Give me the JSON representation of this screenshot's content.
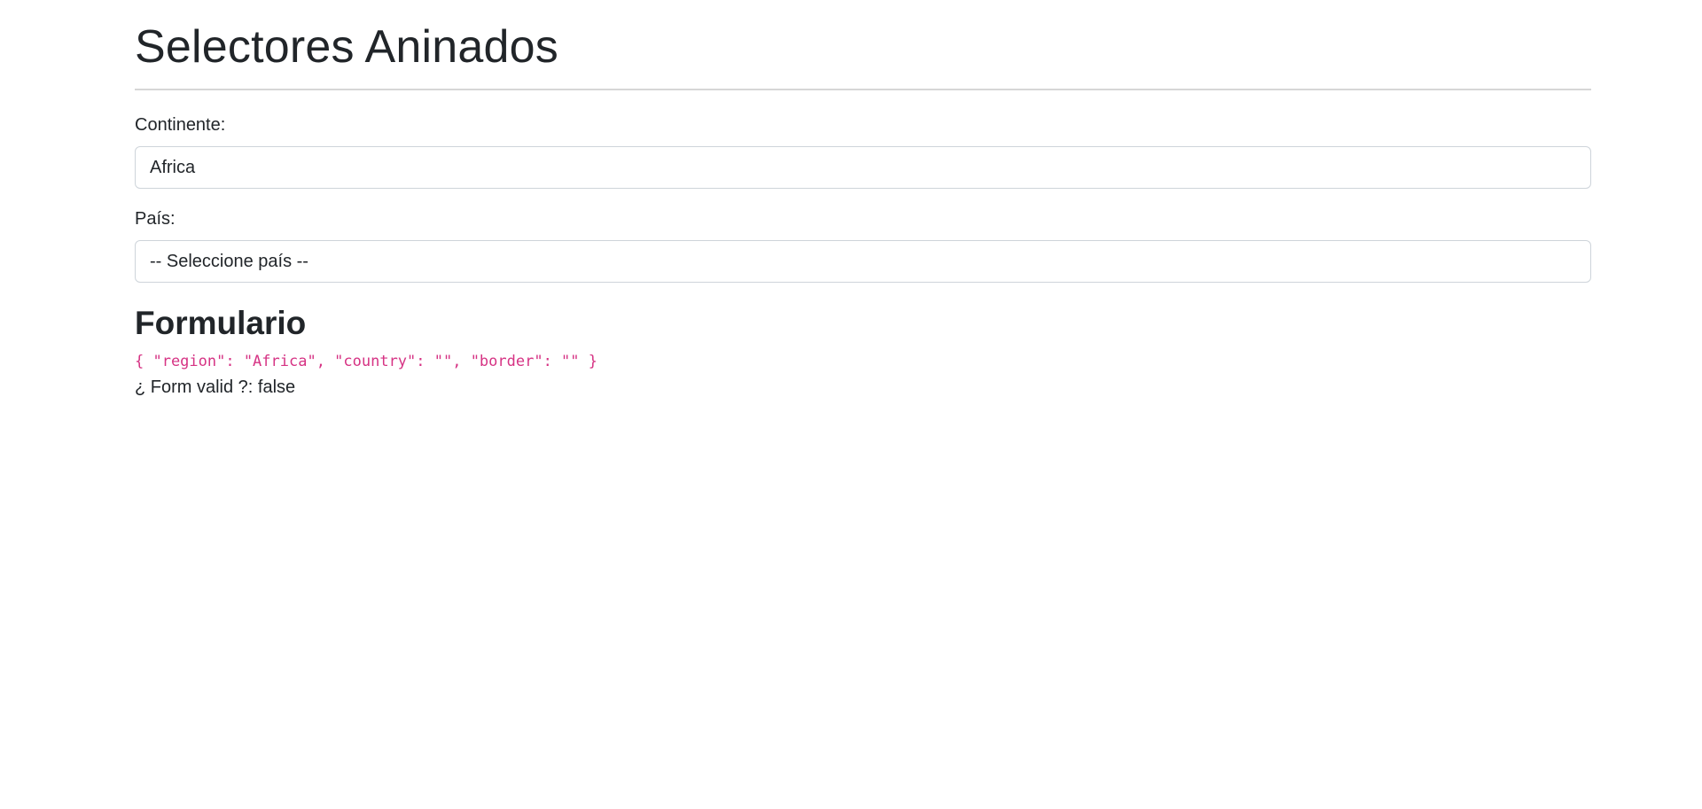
{
  "page": {
    "title": "Selectores Aninados"
  },
  "form": {
    "continent": {
      "label": "Continente:",
      "selected": "Africa"
    },
    "country": {
      "label": "País:",
      "selected": "-- Seleccione país --"
    }
  },
  "debug": {
    "title": "Formulario",
    "json": "{ \"region\": \"Africa\", \"country\": \"\", \"border\": \"\" }",
    "valid_label": "¿ Form valid ?:",
    "valid_value": "false"
  },
  "colors": {
    "code": "#d63384",
    "text": "#212529",
    "border": "#ced4da"
  }
}
